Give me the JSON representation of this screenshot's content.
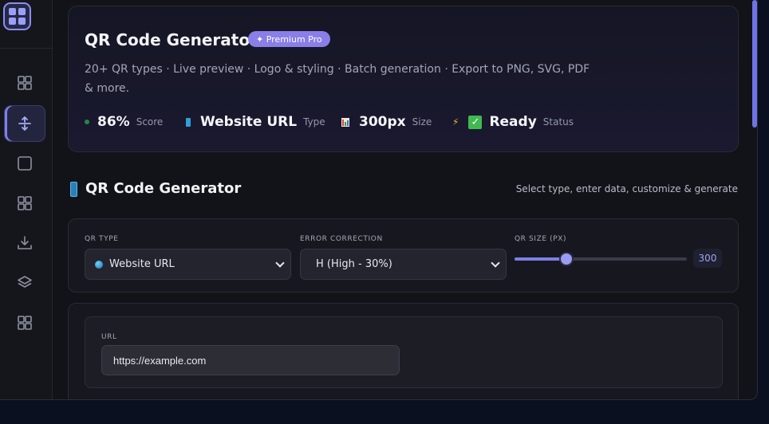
{
  "hero": {
    "title": "QR Code Generator",
    "badge": "✦ Premium Pro",
    "description": "20+ QR types · Live preview · Logo & styling · Batch generation · Export to PNG, SVG, PDF & more.",
    "stats": [
      {
        "value": "86%",
        "label": "Score"
      },
      {
        "value": "Website URL",
        "label": "Type"
      },
      {
        "value": "300px",
        "label": "Size"
      },
      {
        "value": "Ready",
        "label": "Status"
      }
    ]
  },
  "section": {
    "title": "QR Code Generator",
    "subtitle": "Select type, enter data, customize & generate"
  },
  "options": {
    "qr_type_label": "QR TYPE",
    "qr_type_value": "Website URL",
    "error_label": "ERROR CORRECTION",
    "error_value": "H (High - 30%)",
    "size_label": "QR SIZE (PX)",
    "size_value": "300",
    "size_fraction": 0.3
  },
  "url": {
    "label": "URL",
    "value": "https://example.com"
  },
  "sidebar": {
    "items": [
      {
        "icon": "grid-icon"
      },
      {
        "icon": "sort-arrows-icon",
        "active": true
      },
      {
        "icon": "square-icon"
      },
      {
        "icon": "grid-icon"
      },
      {
        "icon": "download-icon"
      },
      {
        "icon": "layers-icon"
      },
      {
        "icon": "grid-icon"
      }
    ]
  },
  "colors": {
    "accent": "#8a7ee8",
    "status_ready": "#3fb950",
    "background": "#121318"
  }
}
